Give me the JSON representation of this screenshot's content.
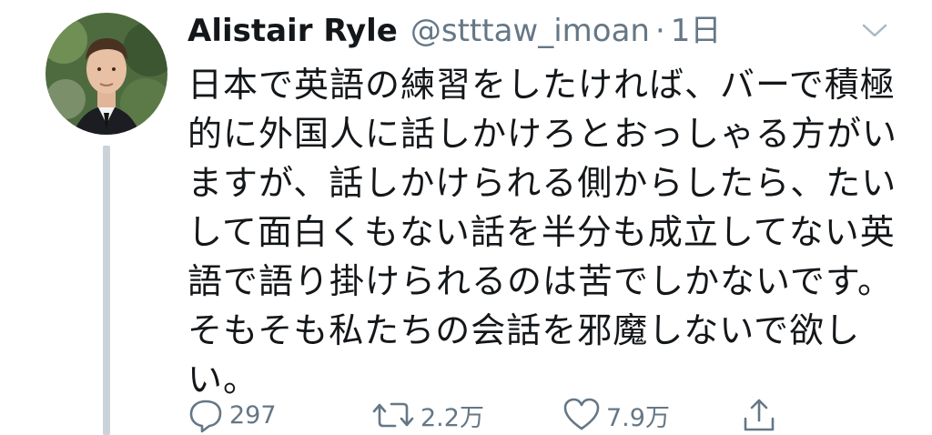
{
  "tweet": {
    "author_name": "Alistair Ryle",
    "handle": "@stttaw_imoan",
    "separator": "·",
    "time": "1日",
    "lines": [
      "日本で英語の練習をしたければ、バーで積極",
      "的に外国人に話しかけろとおっしゃる方がい",
      "ますが、話しかけられる側からしたら、たい",
      "して面白くもない話を半分も成立してない英",
      "語で語り掛けられるのは苦でしかないです。",
      "そもそも私たちの会話を邪魔しないで欲し",
      "い。"
    ]
  },
  "actions": {
    "reply_count": "297",
    "retweet_count": "2.2万",
    "like_count": "7.9万"
  },
  "icons": {
    "reply": "speech-bubble-icon",
    "retweet": "retweet-arrows-icon",
    "like": "heart-icon",
    "share": "share-upload-icon",
    "menu": "chevron-down-icon"
  },
  "colors": {
    "text": "#14171a",
    "muted": "#657786",
    "thread_line": "#cbd3da"
  }
}
